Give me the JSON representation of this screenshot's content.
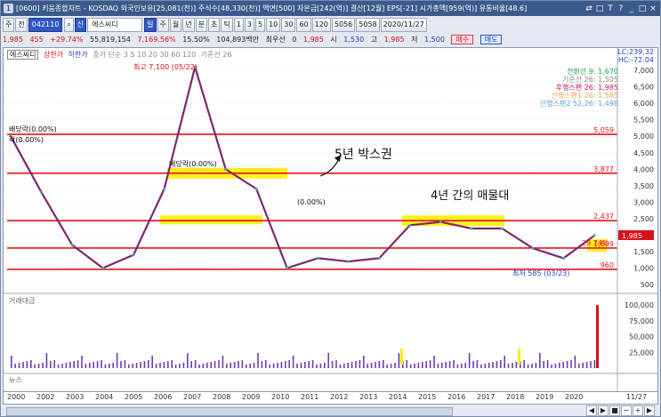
{
  "titlebar": {
    "num": "1",
    "text": "[0600] 키움종합차트 - KOSDAQ 외국인보유[25,081(천)] 주식수[48,330(천)] 액면[500] 자본금[242(억)] 결산[12월] EPS[-21] 시가총액[959(억)] 유통비율[48.6]",
    "controls": [
      "⇄",
      "□",
      "T",
      "?",
      "_",
      "□",
      "×"
    ]
  },
  "toolbar": {
    "menu1": "주",
    "menu2": "전",
    "code": "042110",
    "stock_name": "에스씨디",
    "buttons": [
      "일",
      "주",
      "월",
      "년",
      "분",
      "초",
      "틱"
    ],
    "numbers": [
      "1",
      "3",
      "5",
      "10",
      "30",
      "60",
      "120"
    ],
    "count": "5056",
    "count2": "5058",
    "date": "2020/11/27"
  },
  "quote": {
    "price": "1,985",
    "change": "455",
    "change_pct": "+29.74%",
    "volume": "55,819,154",
    "vol_pct": "7,169.56%",
    "turnover": "15.50%",
    "amount": "104,893백만",
    "label_min": "최우선",
    "zero": "0",
    "bid": "1,985",
    "open_label": "시",
    "open": "1,530",
    "high_label": "고",
    "high": "1,985",
    "low_label": "저",
    "low": "1,500",
    "buy": "매수",
    "sell": "매도"
  },
  "legend": {
    "name": "에스씨디",
    "limit_up": "상한가",
    "limit_down": "하한가",
    "close_label": "종가 단순 3 5 10 20 30 60 120",
    "ma_label": "기준선 26",
    "lc": "LC:239.32",
    "hc": "HC:-72.04"
  },
  "ichimoku": {
    "l1": "전환선 9: 1,670",
    "l2": "기준선 26: 1,505",
    "l3": "후행스팬 26: 1,985",
    "l4": "선행스팬1 26: 1,585",
    "l5": "선행스팬2 52,26: 1,498"
  },
  "annotations": {
    "high": "최고 7,100 (05/22)",
    "low": "최저 585 (03/23)",
    "box5": "5년 박스권",
    "box4": "4년 간의 매물대",
    "div1": "배당락(0.00%)",
    "zero": "(0.00%)",
    "pct_left1": "배당락(0.00%)",
    "pct_left2": "락(0.00%)"
  },
  "hlines": [
    {
      "label": "5,059",
      "color": "#e8141c"
    },
    {
      "label": "3,877",
      "color": "#e8141c"
    },
    {
      "label": "2,437",
      "color": "#e8141c"
    },
    {
      "label": "1,609",
      "color": "#e8141c"
    },
    {
      "label": "960",
      "color": "#e8141c"
    }
  ],
  "price_axis": [
    "7,000",
    "6,500",
    "6,000",
    "5,500",
    "5,000",
    "4,500",
    "4,000",
    "3,500",
    "3,000",
    "2,500",
    "2,000",
    "1,500",
    "1,000",
    "500"
  ],
  "current_price_tag": "1,985",
  "current_pct_tag": "29.74%",
  "volume_panel": {
    "title": "거래대금",
    "axis": [
      "100,000",
      "75,000",
      "50,000",
      "25,000"
    ]
  },
  "news_panel": {
    "title": "뉴스"
  },
  "xaxis": [
    "2000",
    "2002",
    "2003",
    "2004",
    "2005",
    "2006",
    "2007",
    "2008",
    "2009",
    "2010",
    "2011",
    "2012",
    "2013",
    "2014",
    "2015",
    "2016",
    "2017",
    "2018",
    "2019",
    "2020",
    "11/27"
  ],
  "chart_data": {
    "type": "line",
    "title": "에스씨디",
    "x": [
      "2000",
      "2002",
      "2003",
      "2004",
      "2005",
      "2006",
      "2007",
      "2008",
      "2009",
      "2010",
      "2011",
      "2012",
      "2013",
      "2014",
      "2015",
      "2016",
      "2017",
      "2018",
      "2019",
      "2020"
    ],
    "series": [
      {
        "name": "에스씨디",
        "values": [
          5000,
          3300,
          1700,
          1000,
          1400,
          3400,
          7100,
          4000,
          3400,
          1000,
          1300,
          1200,
          1300,
          2300,
          2400,
          2200,
          2200,
          1600,
          1300,
          1985
        ]
      }
    ],
    "ylim": [
      500,
      7300
    ],
    "horizontal_levels": [
      5059,
      3877,
      2437,
      1609,
      960
    ],
    "high": 7100,
    "low": 585
  }
}
